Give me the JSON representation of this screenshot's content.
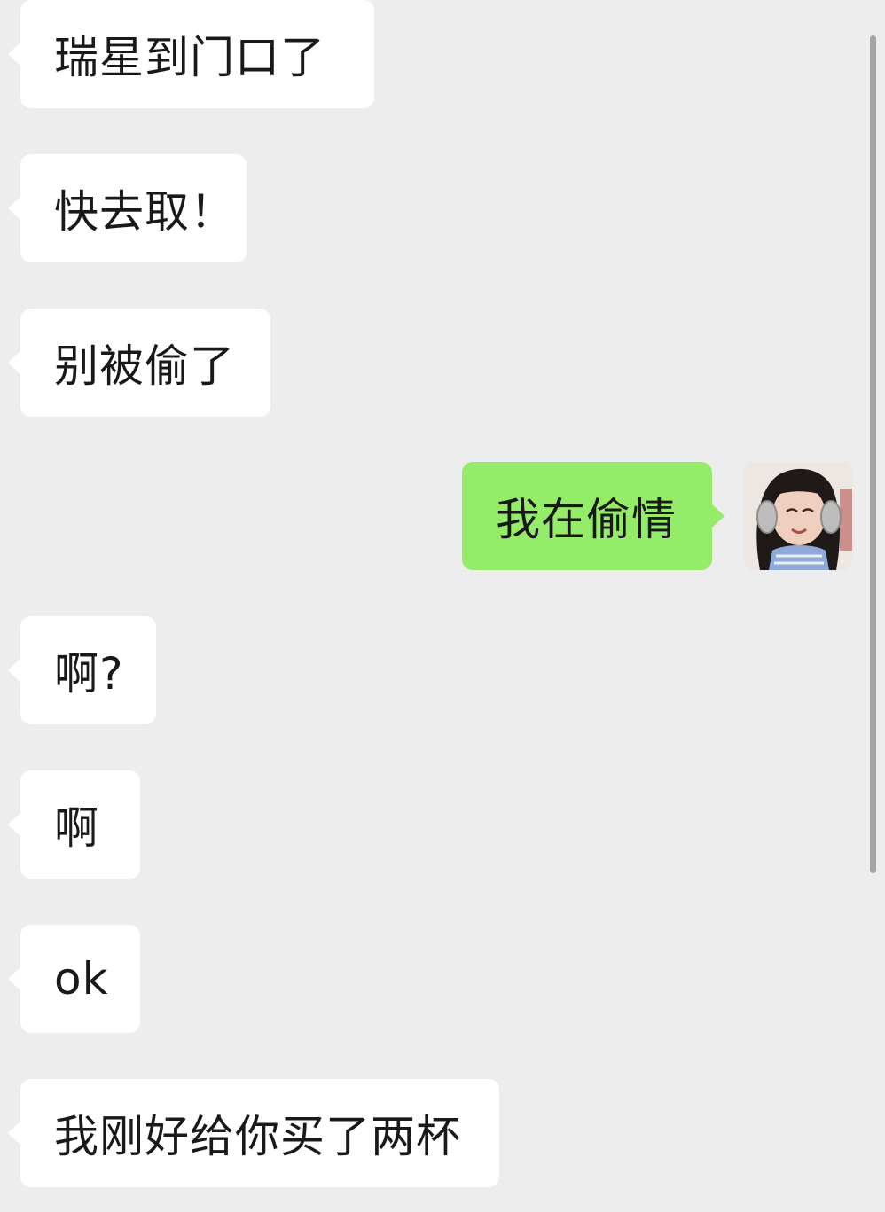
{
  "chat": {
    "messages": [
      {
        "side": "in",
        "text": "瑞星到门口了"
      },
      {
        "side": "in",
        "text": "快去取！"
      },
      {
        "side": "in",
        "text": "别被偷了"
      },
      {
        "side": "out",
        "text": "我在偷情"
      },
      {
        "side": "in",
        "text": "啊?"
      },
      {
        "side": "in",
        "text": "啊"
      },
      {
        "side": "in",
        "text": "ok"
      },
      {
        "side": "in",
        "text": "我刚好给你买了两杯"
      }
    ],
    "avatar_icon": "user-avatar-photo",
    "colors": {
      "background": "#ededed",
      "incoming_bubble": "#ffffff",
      "outgoing_bubble": "#95ec69",
      "text": "#191919"
    }
  }
}
